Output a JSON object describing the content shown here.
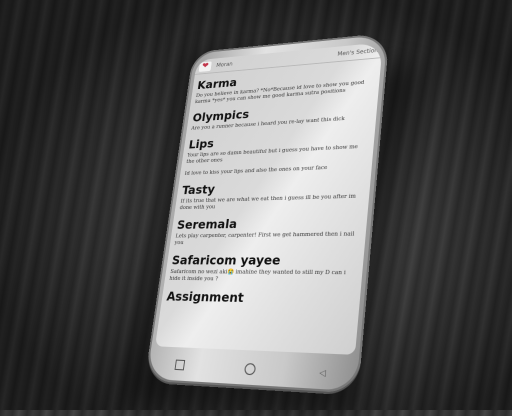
{
  "app": {
    "name": "Moran",
    "section": "Men's Section"
  },
  "posts": [
    {
      "title": "Karma",
      "text": "Do you believe in karma? *No*Because id love to show you good karma *yes* you can show me good karma sutra positions"
    },
    {
      "title": "Olympics",
      "text": "Are you a runner because i heard you re-lay want this dick"
    },
    {
      "title": "Lips",
      "text": "Your lips are so damn beautiful but i guess you have to show me the other ones"
    },
    {
      "title": "",
      "text": "Id love to kiss your lips and also the ones on your face"
    },
    {
      "title": "Tasty",
      "text": "If its true that we are what we eat then i guess ill be you after im done with you"
    },
    {
      "title": "Seremala",
      "text": "Lets play carpenter, carpenter! First we get hammered then i nail you"
    },
    {
      "title": "Safaricom yayee",
      "text": "Safaricom no wezi aki😭 imahine they wanted to still my D can i hide it inside you ?"
    },
    {
      "title": "Assignment",
      "text": ""
    }
  ],
  "navigation": {
    "recents": "recents-icon",
    "home": "home-icon",
    "back": "back-icon"
  }
}
